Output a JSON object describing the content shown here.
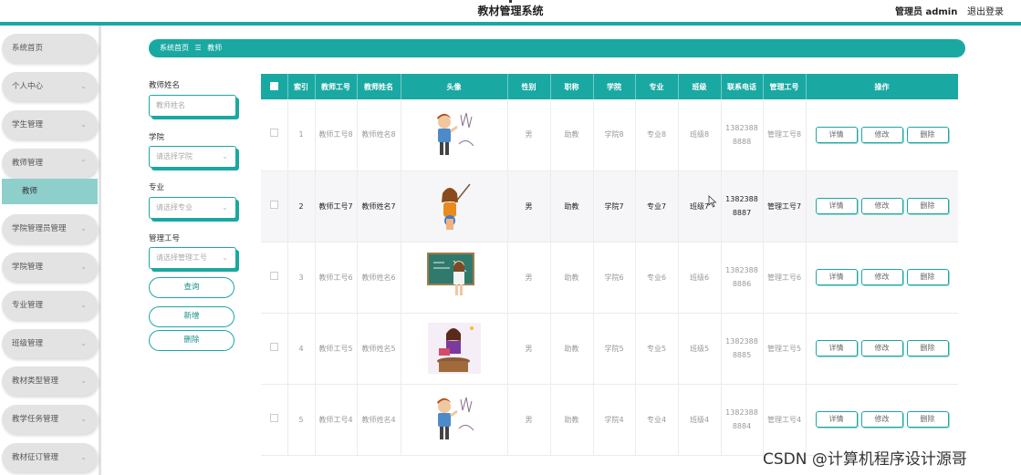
{
  "app": {
    "title": "教材管理系统",
    "user": "管理员 admin",
    "logout": "退出登录"
  },
  "sidebar": {
    "items": [
      {
        "label": "系统首页"
      },
      {
        "label": "个人中心"
      },
      {
        "label": "学生管理"
      },
      {
        "label": "教师管理"
      },
      {
        "label": "学院管理员管理"
      },
      {
        "label": "学院管理"
      },
      {
        "label": "专业管理"
      },
      {
        "label": "班级管理"
      },
      {
        "label": "教材类型管理"
      },
      {
        "label": "教学任务管理"
      },
      {
        "label": "教材征订管理"
      }
    ],
    "submenu_label": "教师"
  },
  "breadcrumb": {
    "home": "系统首页",
    "sep": "☰",
    "current": "教师"
  },
  "filters": {
    "name_label": "教师姓名",
    "name_placeholder": "教师姓名",
    "college_label": "学院",
    "college_placeholder": "请选择学院",
    "major_label": "专业",
    "major_placeholder": "请选择专业",
    "admin_label": "管理工号",
    "admin_placeholder": "请选择管理工号",
    "search_btn": "查询",
    "add_btn": "新增",
    "delete_btn": "删除"
  },
  "table": {
    "headers": [
      "索引",
      "教师工号",
      "教师姓名",
      "头像",
      "性别",
      "职称",
      "学院",
      "专业",
      "班级",
      "联系电话",
      "管理工号",
      "操作"
    ],
    "actions": {
      "detail": "详情",
      "edit": "修改",
      "delete": "删除"
    },
    "rows": [
      {
        "index": "1",
        "teacher_no": "教师工号8",
        "teacher_name": "教师姓名8",
        "gender": "男",
        "title": "助教",
        "college": "学院8",
        "major": "专业8",
        "class": "班级8",
        "phone": "13823888888",
        "admin_no": "管理工号8"
      },
      {
        "index": "2",
        "teacher_no": "教师工号7",
        "teacher_name": "教师姓名7",
        "gender": "男",
        "title": "助教",
        "college": "学院7",
        "major": "专业7",
        "class": "班级7",
        "phone": "13823888887",
        "admin_no": "管理工号7"
      },
      {
        "index": "3",
        "teacher_no": "教师工号6",
        "teacher_name": "教师姓名6",
        "gender": "男",
        "title": "助教",
        "college": "学院6",
        "major": "专业6",
        "class": "班级6",
        "phone": "13823888886",
        "admin_no": "管理工号6"
      },
      {
        "index": "4",
        "teacher_no": "教师工号5",
        "teacher_name": "教师姓名5",
        "gender": "男",
        "title": "助教",
        "college": "学院5",
        "major": "专业5",
        "class": "班级5",
        "phone": "13823888885",
        "admin_no": "管理工号5"
      },
      {
        "index": "5",
        "teacher_no": "教师工号4",
        "teacher_name": "教师姓名4",
        "gender": "男",
        "title": "助教",
        "college": "学院4",
        "major": "专业4",
        "class": "班级4",
        "phone": "13823888884",
        "admin_no": "管理工号4"
      }
    ]
  },
  "watermark": "CSDN @计算机程序设计源哥",
  "colors": {
    "accent": "#1aa8a2",
    "submenu": "#8ecfcc",
    "menu_bg": "#e3e3e3"
  }
}
